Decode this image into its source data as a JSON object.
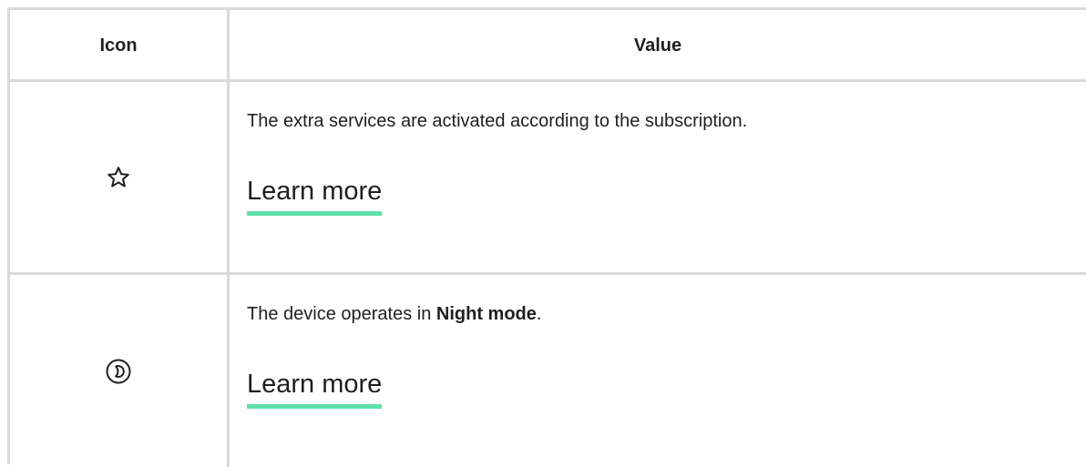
{
  "table": {
    "headers": {
      "icon": "Icon",
      "value": "Value"
    },
    "rows": [
      {
        "icon": "star-outline-icon",
        "description": "The extra services are activated according to the subscription.",
        "link_label": "Learn more"
      },
      {
        "icon": "night-mode-icon",
        "description_prefix": "The device operates in ",
        "description_bold": "Night mode",
        "description_suffix": ".",
        "link_label": "Learn more"
      }
    ]
  },
  "colors": {
    "border": "#d9d9d9",
    "text": "#1f1f1f",
    "link_underline": "#5fe0a8"
  }
}
